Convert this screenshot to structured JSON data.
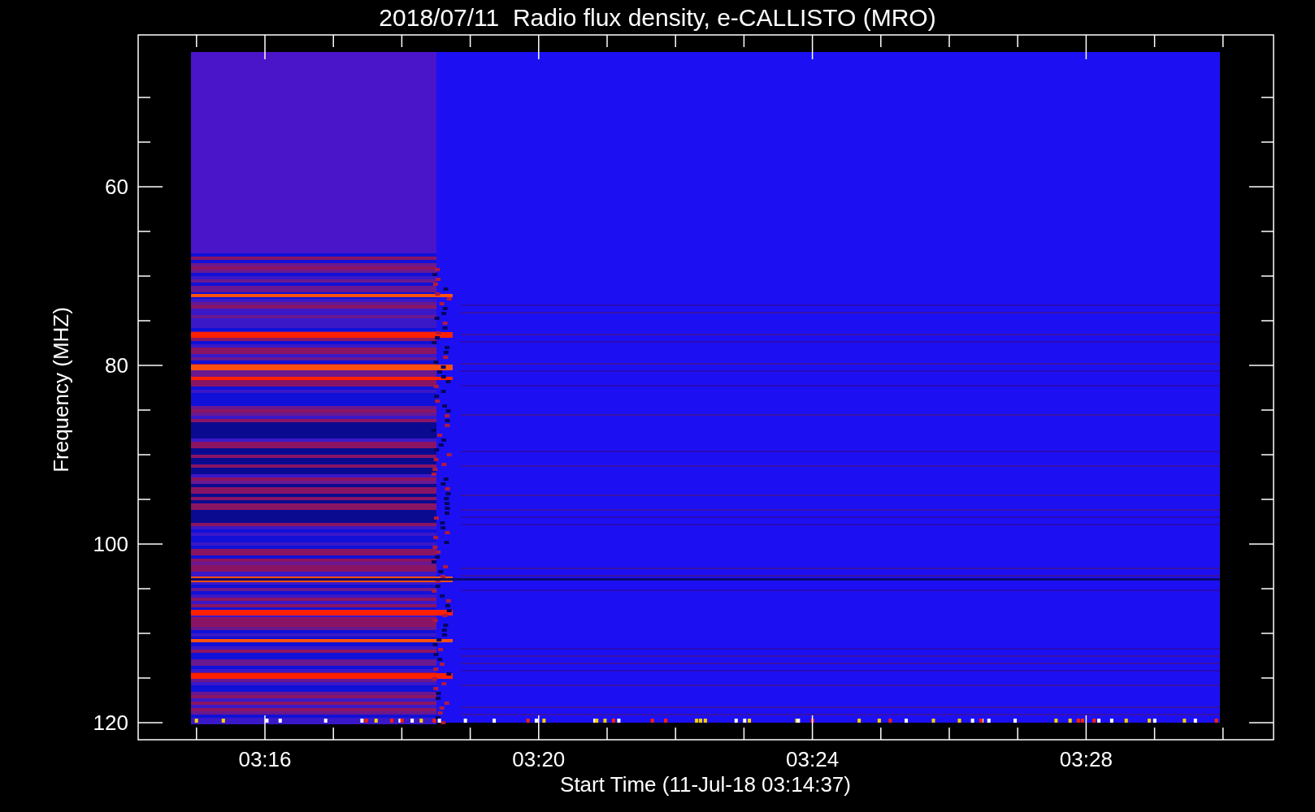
{
  "title": "2018/07/11  Radio flux density, e-CALLISTO (MRO)",
  "ylabel": "Frequency (MHZ)",
  "xlabel": "Start Time (11-Jul-18 03:14:37)",
  "yticks": [
    "60",
    "80",
    "100",
    "120"
  ],
  "xticks": [
    "03:16",
    "03:20",
    "03:24",
    "03:28"
  ]
}
